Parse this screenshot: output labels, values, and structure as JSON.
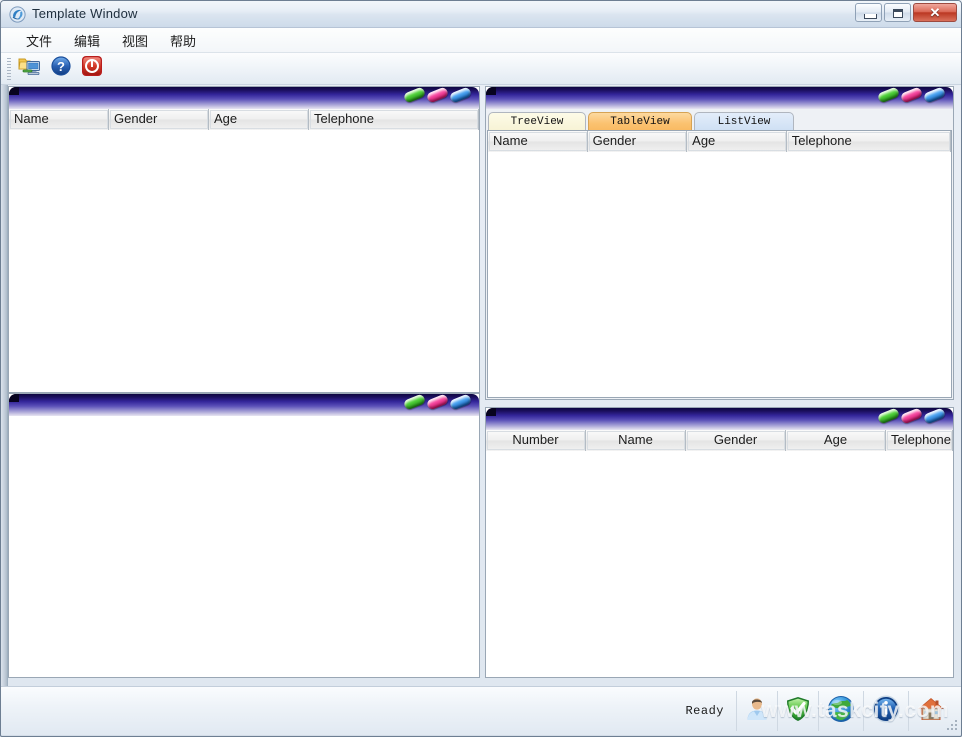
{
  "window": {
    "title": "Template Window",
    "app_icon": "qt-logo-icon",
    "buttons": {
      "minimize": "minimize-icon",
      "maximize": "maximize-icon",
      "close": "✕"
    }
  },
  "menubar": {
    "items": [
      {
        "label": "文件"
      },
      {
        "label": "编辑"
      },
      {
        "label": "视图"
      },
      {
        "label": "帮助"
      }
    ]
  },
  "toolbar": {
    "buttons": [
      {
        "icon": "network-computer-icon",
        "label": ""
      },
      {
        "icon": "help-question-icon",
        "label": ""
      },
      {
        "icon": "power-stop-icon",
        "label": ""
      }
    ]
  },
  "panels": {
    "top_left": {
      "decor_pills": [
        "green",
        "pink",
        "blue"
      ],
      "table": {
        "columns": [
          "Name",
          "Gender",
          "Age",
          "Telephone"
        ],
        "rows": []
      }
    },
    "bottom_left": {
      "decor_pills": [
        "green",
        "pink",
        "blue"
      ],
      "table": {
        "columns": [],
        "rows": []
      }
    },
    "top_right": {
      "decor_pills": [
        "green",
        "pink",
        "blue"
      ],
      "tabs": [
        {
          "label": "TreeView",
          "selected": false
        },
        {
          "label": "TableView",
          "selected": true
        },
        {
          "label": "ListView",
          "selected": false
        }
      ],
      "table": {
        "columns": [
          "Name",
          "Gender",
          "Age",
          "Telephone"
        ],
        "rows": []
      }
    },
    "bottom_right": {
      "decor_pills": [
        "green",
        "pink",
        "blue"
      ],
      "table": {
        "columns": [
          "Number",
          "Name",
          "Gender",
          "Age",
          "Telephone"
        ],
        "rows": []
      }
    }
  },
  "statusbar": {
    "message": "Ready",
    "icons": [
      {
        "name": "user-icon"
      },
      {
        "name": "shield-check-icon"
      },
      {
        "name": "globe-icon"
      },
      {
        "name": "info-icon"
      },
      {
        "name": "home-icon"
      }
    ],
    "watermark": "www.taskcity.com"
  },
  "colors": {
    "panel_header_dark": "#0d0540",
    "panel_header_light": "#e8e6f3",
    "tab_selected": "#f9bb63",
    "close_button": "#bb3823"
  }
}
